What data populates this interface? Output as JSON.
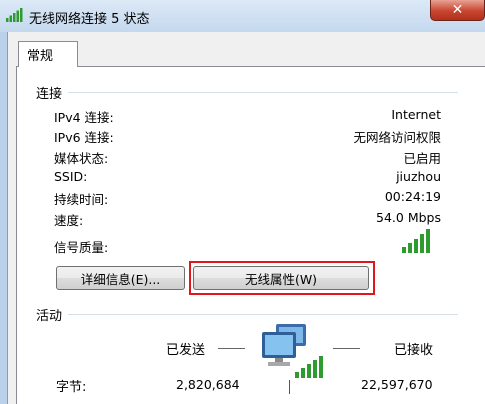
{
  "window": {
    "title": "无线网络连接 5 状态",
    "close_glyph": "✕"
  },
  "tabs": [
    {
      "label": "常规"
    }
  ],
  "connection": {
    "group_label": "连接",
    "rows": [
      {
        "label": "IPv4 连接:",
        "value": "Internet"
      },
      {
        "label": "IPv6 连接:",
        "value": "无网络访问权限"
      },
      {
        "label": "媒体状态:",
        "value": "已启用"
      },
      {
        "label": "SSID:",
        "value": "jiuzhou"
      },
      {
        "label": "持续时间:",
        "value": "00:24:19"
      },
      {
        "label": "速度:",
        "value": "54.0 Mbps"
      }
    ],
    "signal_label": "信号质量:",
    "signal_bars_level": 5,
    "details_button": "详细信息(E)...",
    "wireless_props_button": "无线属性(W)"
  },
  "activity": {
    "group_label": "活动",
    "sent_label": "已发送",
    "received_label": "已接收",
    "bytes_label": "字节:",
    "bytes_sent": "2,820,684",
    "bytes_received": "22,597,670",
    "icon": "network-computers-icon"
  },
  "colors": {
    "highlight": "#e0171a",
    "signal_green": "#2f9a2f"
  }
}
